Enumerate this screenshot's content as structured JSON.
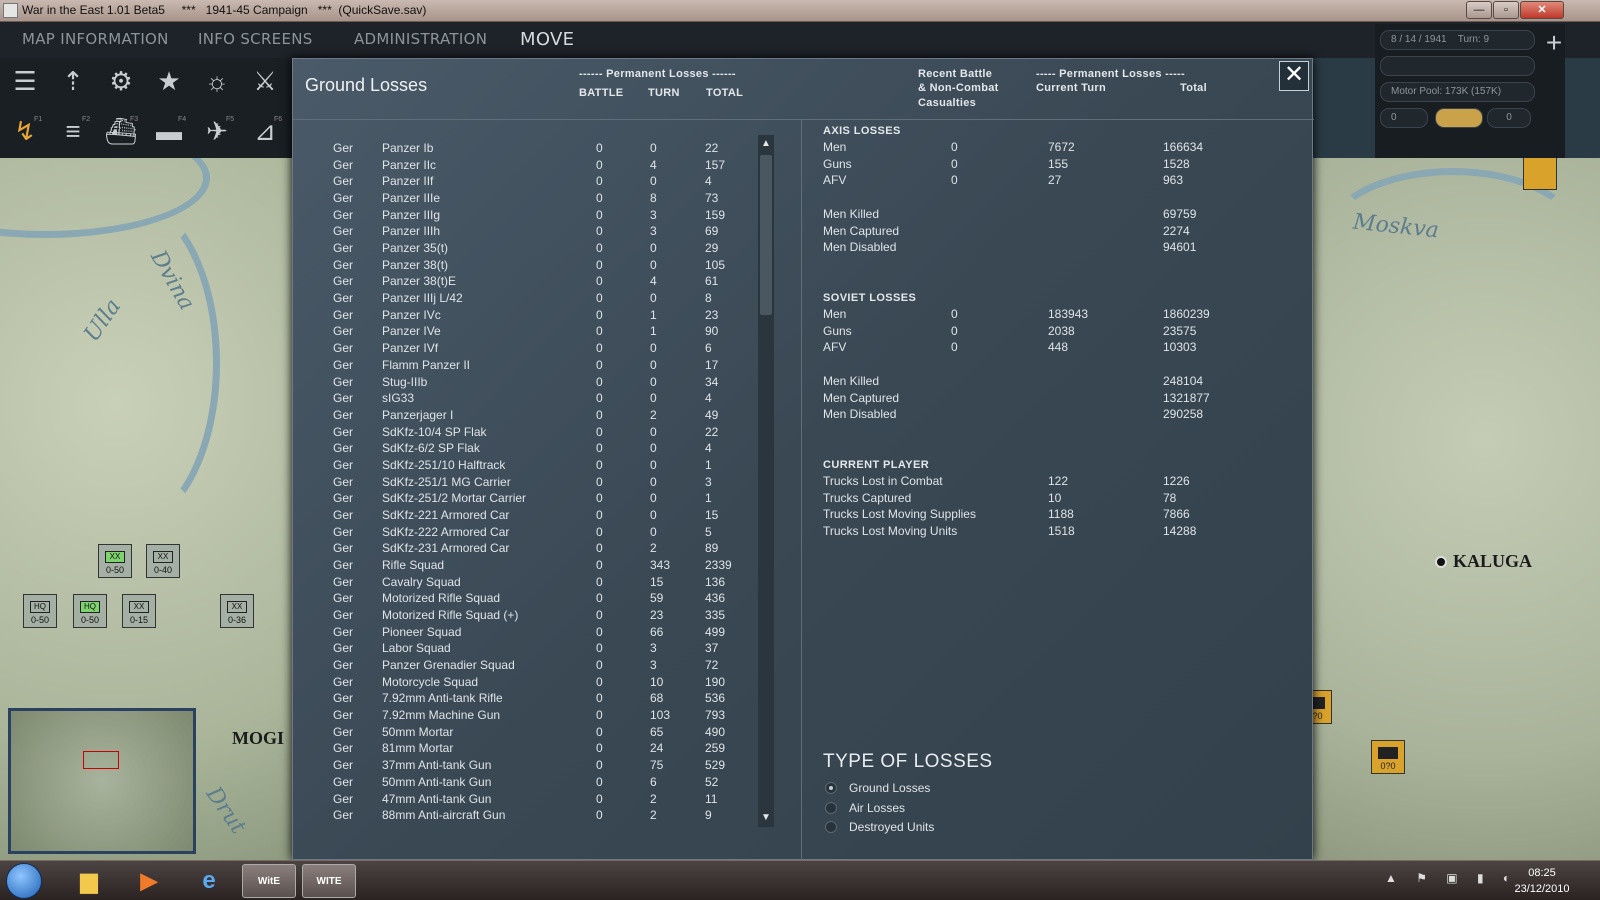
{
  "window": {
    "title": "War in the East 1.01 Beta5     ***   1941-45 Campaign   ***  (QuickSave.sav)",
    "min_label": "—",
    "max_label": "▫",
    "close_label": "✕"
  },
  "menu": {
    "map_info": "MAP INFORMATION",
    "info_screens": "INFO SCREENS",
    "administration": "ADMINISTRATION",
    "move": "MOVE"
  },
  "toolbar": {
    "f1": "F1",
    "f2": "F2",
    "f3": "F3",
    "f4": "F4",
    "f5": "F5",
    "f6": "F6"
  },
  "status": {
    "date": "8 / 14 / 1941",
    "turn": "Turn: 9",
    "motor_pool": "Motor Pool: 173K (157K)",
    "value": "0",
    "small": "0"
  },
  "map": {
    "ulla": "Ulla",
    "dvina": "Dvina",
    "moskva": "Moskva",
    "drut": "Drut",
    "mogi": "MOGI",
    "kaluga": "KALUGA",
    "counters_left": [
      {
        "code": "XX",
        "val": "0-50"
      },
      {
        "code": "XX",
        "val": "0-40"
      },
      {
        "code": "XXX",
        "val": "0-50",
        "hq": "HQ"
      },
      {
        "code": "XXXX",
        "val": "0-50",
        "hq": "HQ"
      },
      {
        "code": "XX",
        "val": "0-15"
      },
      {
        "code": "XX",
        "val": "0-36"
      }
    ],
    "counters_right": [
      {
        "val": "0?0"
      },
      {
        "val": "0?0"
      }
    ]
  },
  "dialog": {
    "title": "Ground Losses",
    "close": "✕",
    "left_header": {
      "group": "------ Permanent Losses ------",
      "battle": "BATTLE",
      "turn": "TURN",
      "total": "TOTAL"
    },
    "right_header": {
      "recent1": "Recent Battle",
      "recent2": "& Non-Combat",
      "recent3": "Casualties",
      "group": "----- Permanent Losses -----",
      "current": "Current Turn",
      "total": "Total"
    },
    "units": [
      [
        "Ger",
        "Panzer Ib",
        "0",
        "0",
        "22"
      ],
      [
        "Ger",
        "Panzer IIc",
        "0",
        "4",
        "157"
      ],
      [
        "Ger",
        "Panzer IIf",
        "0",
        "0",
        "4"
      ],
      [
        "Ger",
        "Panzer IIIe",
        "0",
        "8",
        "73"
      ],
      [
        "Ger",
        "Panzer IIIg",
        "0",
        "3",
        "159"
      ],
      [
        "Ger",
        "Panzer IIIh",
        "0",
        "3",
        "69"
      ],
      [
        "Ger",
        "Panzer 35(t)",
        "0",
        "0",
        "29"
      ],
      [
        "Ger",
        "Panzer 38(t)",
        "0",
        "0",
        "105"
      ],
      [
        "Ger",
        "Panzer 38(t)E",
        "0",
        "4",
        "61"
      ],
      [
        "Ger",
        "Panzer IIIj L/42",
        "0",
        "0",
        "8"
      ],
      [
        "Ger",
        "Panzer IVc",
        "0",
        "1",
        "23"
      ],
      [
        "Ger",
        "Panzer IVe",
        "0",
        "1",
        "90"
      ],
      [
        "Ger",
        "Panzer IVf",
        "0",
        "0",
        "6"
      ],
      [
        "Ger",
        "Flamm Panzer II",
        "0",
        "0",
        "17"
      ],
      [
        "Ger",
        "Stug-IIIb",
        "0",
        "0",
        "34"
      ],
      [
        "Ger",
        "sIG33",
        "0",
        "0",
        "4"
      ],
      [
        "Ger",
        "Panzerjager I",
        "0",
        "2",
        "49"
      ],
      [
        "Ger",
        "SdKfz-10/4 SP Flak",
        "0",
        "0",
        "22"
      ],
      [
        "Ger",
        "SdKfz-6/2 SP Flak",
        "0",
        "0",
        "4"
      ],
      [
        "Ger",
        "SdKfz-251/10 Halftrack",
        "0",
        "0",
        "1"
      ],
      [
        "Ger",
        "SdKfz-251/1 MG Carrier",
        "0",
        "0",
        "3"
      ],
      [
        "Ger",
        "SdKfz-251/2 Mortar Carrier",
        "0",
        "0",
        "1"
      ],
      [
        "Ger",
        "SdKfz-221 Armored Car",
        "0",
        "0",
        "15"
      ],
      [
        "Ger",
        "SdKfz-222 Armored Car",
        "0",
        "0",
        "5"
      ],
      [
        "Ger",
        "SdKfz-231 Armored Car",
        "0",
        "2",
        "89"
      ],
      [
        "Ger",
        "Rifle Squad",
        "0",
        "343",
        "2339"
      ],
      [
        "Ger",
        "Cavalry Squad",
        "0",
        "15",
        "136"
      ],
      [
        "Ger",
        "Motorized Rifle Squad",
        "0",
        "59",
        "436"
      ],
      [
        "Ger",
        "Motorized Rifle Squad (+)",
        "0",
        "23",
        "335"
      ],
      [
        "Ger",
        "Pioneer Squad",
        "0",
        "66",
        "499"
      ],
      [
        "Ger",
        "Labor Squad",
        "0",
        "3",
        "37"
      ],
      [
        "Ger",
        "Panzer Grenadier Squad",
        "0",
        "3",
        "72"
      ],
      [
        "Ger",
        "Motorcycle Squad",
        "0",
        "10",
        "190"
      ],
      [
        "Ger",
        "7.92mm Anti-tank Rifle",
        "0",
        "68",
        "536"
      ],
      [
        "Ger",
        "7.92mm Machine Gun",
        "0",
        "103",
        "793"
      ],
      [
        "Ger",
        "50mm Mortar",
        "0",
        "65",
        "490"
      ],
      [
        "Ger",
        "81mm Mortar",
        "0",
        "24",
        "259"
      ],
      [
        "Ger",
        "37mm Anti-tank Gun",
        "0",
        "75",
        "529"
      ],
      [
        "Ger",
        "50mm Anti-tank Gun",
        "0",
        "6",
        "52"
      ],
      [
        "Ger",
        "47mm Anti-tank Gun",
        "0",
        "2",
        "11"
      ],
      [
        "Ger",
        "88mm Anti-aircraft Gun",
        "0",
        "2",
        "9"
      ]
    ],
    "axis_title": "AXIS LOSSES",
    "axis": [
      [
        "Men",
        "0",
        "7672",
        "166634"
      ],
      [
        "Guns",
        "0",
        "155",
        "1528"
      ],
      [
        "AFV",
        "0",
        "27",
        "963"
      ]
    ],
    "axis_detail": [
      [
        "Men Killed",
        "69759"
      ],
      [
        "Men Captured",
        "2274"
      ],
      [
        "Men Disabled",
        "94601"
      ]
    ],
    "soviet_title": "SOVIET LOSSES",
    "soviet": [
      [
        "Men",
        "0",
        "183943",
        "1860239"
      ],
      [
        "Guns",
        "0",
        "2038",
        "23575"
      ],
      [
        "AFV",
        "0",
        "448",
        "10303"
      ]
    ],
    "soviet_detail": [
      [
        "Men Killed",
        "248104"
      ],
      [
        "Men Captured",
        "1321877"
      ],
      [
        "Men Disabled",
        "290258"
      ]
    ],
    "player_title": "CURRENT PLAYER",
    "player": [
      [
        "Trucks Lost in Combat",
        "122",
        "1226"
      ],
      [
        "Trucks Captured",
        "10",
        "78"
      ],
      [
        "Trucks Lost Moving Supplies",
        "1188",
        "7866"
      ],
      [
        "Trucks Lost Moving Units",
        "1518",
        "14288"
      ]
    ],
    "type_title": "TYPE OF LOSSES",
    "types": [
      {
        "label": "Ground Losses",
        "selected": true
      },
      {
        "label": "Air Losses",
        "selected": false
      },
      {
        "label": "Destroyed Units",
        "selected": false
      }
    ]
  },
  "taskbar": {
    "app1": "WitE",
    "app2": "WITE",
    "time": "08:25",
    "date": "23/12/2010",
    "tray": "▲ ⚑ ▣ ▮ ◐"
  }
}
